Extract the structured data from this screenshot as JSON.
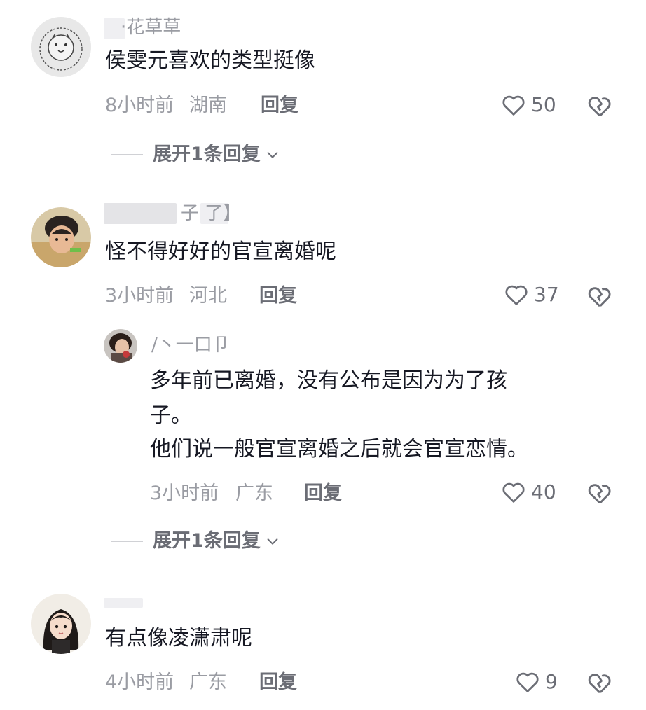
{
  "comments": [
    {
      "username": "·花草草",
      "text": "侯雯元喜欢的类型挺像",
      "time": "8小时前",
      "location": "湖南",
      "reply_label": "回复",
      "likes": "50",
      "expand_label": "展开1条回复"
    },
    {
      "username": "子 了】",
      "text": "怪不得好好的官宣离婚呢",
      "time": "3小时前",
      "location": "河北",
      "reply_label": "回复",
      "likes": "37",
      "reply": {
        "username": "/丶一口卩",
        "text_line1": "多年前已离婚，没有公布是因为为了孩",
        "text_line2": "子。",
        "text_line3": "他们说一般官宣离婚之后就会官宣恋情。",
        "time": "3小时前",
        "location": "广东",
        "reply_label": "回复",
        "likes": "40"
      },
      "expand_label": "展开1条回复"
    },
    {
      "username": "",
      "text": "有点像凌潇肃呢",
      "time": "4小时前",
      "location": "广东",
      "reply_label": "回复",
      "likes": "9"
    }
  ]
}
